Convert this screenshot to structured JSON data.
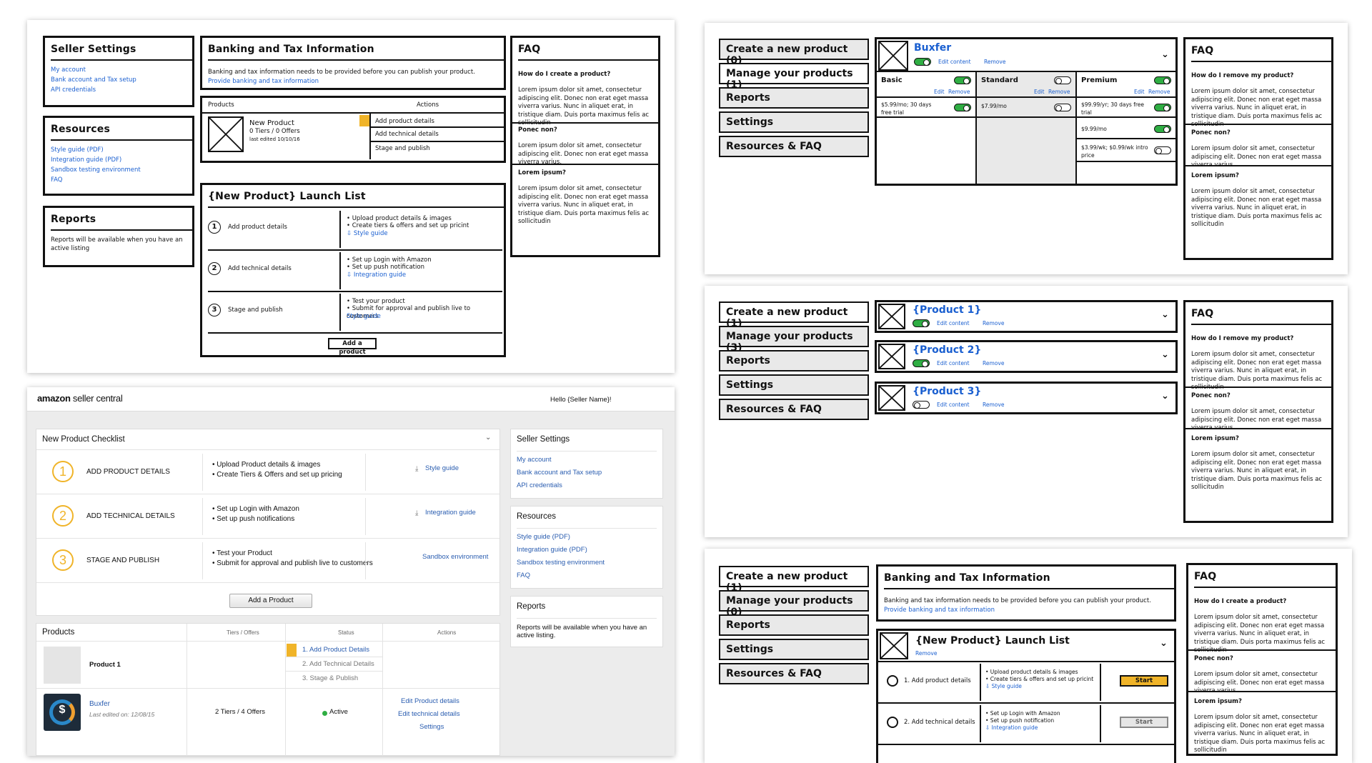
{
  "wf1": {
    "seller_settings": {
      "title": "Seller Settings",
      "links": [
        "My account",
        "Bank account and Tax setup",
        "API credentials"
      ]
    },
    "resources": {
      "title": "Resources",
      "links": [
        "Style guide (PDF)",
        "Integration guide (PDF)",
        "Sandbox testing environment",
        "FAQ"
      ]
    },
    "reports": {
      "title": "Reports",
      "text": "Reports will be available when you have an active listing"
    },
    "banking": {
      "title": "Banking and Tax Information",
      "text": "Banking and tax information needs to be provided before you can publish your product.",
      "link": "Provide banking and tax information"
    },
    "products": {
      "col_products": "Products",
      "col_actions": "Actions",
      "name": "New Product",
      "sub1": "0 Tiers / 0 Offers",
      "sub2": "last edited 10/10/16",
      "actions": [
        "Add product details",
        "Add technical details",
        "Stage and publish"
      ]
    },
    "launch": {
      "title": "{New Product} Launch List",
      "steps": [
        {
          "num": "1",
          "label": "Add product details",
          "items": [
            "• Upload product details & images",
            "• Create tiers & offers and set up pricint"
          ],
          "link": "⇩ Style guide"
        },
        {
          "num": "2",
          "label": "Add technical details",
          "items": [
            "• Set up Login with Amazon",
            "• Set up push notification"
          ],
          "link": "⇩ Integration guide"
        },
        {
          "num": "3",
          "label": "Stage and publish",
          "items": [
            "• Test your product",
            "• Submit for approval and publish live to customers"
          ],
          "link": "Style guide"
        }
      ],
      "button": "Add a product"
    },
    "faq": {
      "title": "FAQ",
      "q1": "How do I create a product?",
      "a1": "Lorem ipsum dolor sit amet, consectetur adipiscing elit. Donec non erat eget massa viverra varius. Nunc in aliquet erat, in tristique diam. Duis porta maximus felis ac sollicitudin",
      "q2": "Ponec non?",
      "a2": "Lorem ipsum dolor sit amet, consectetur adipiscing elit. Donec non erat eget massa viverra varius.",
      "q3": "Lorem ipsum?",
      "a3": "Lorem ipsum dolor sit amet, consectetur adipiscing elit. Donec non erat eget massa viverra varius. Nunc in aliquet erat, in tristique diam. Duis porta maximus felis ac sollicitudin"
    }
  },
  "wf2": {
    "nav": [
      "Create a new product (0)",
      "Manage your products (1)",
      "Reports",
      "Settings",
      "Resources & FAQ"
    ],
    "product": "Buxfer",
    "edit": "Edit content",
    "remove": "Remove",
    "tiers": [
      {
        "name": "Basic",
        "price": "$5.99/mo; 30 days free trial"
      },
      {
        "name": "Standard",
        "price": "$7.99/mo"
      },
      {
        "name": "Premium",
        "prices": [
          "$99.99/yr; 30 days free trial",
          "$9.99/mo",
          "$3.99/wk; $0.99/wk intro price"
        ]
      }
    ],
    "tier_edit": "Edit",
    "tier_remove": "Remove",
    "faq": {
      "title": "FAQ",
      "q1": "How do I remove my product?",
      "a1": "Lorem ipsum dolor sit amet, consectetur adipiscing elit. Donec non erat eget massa viverra varius. Nunc in aliquet erat, in tristique diam. Duis porta maximus felis ac sollicitudin",
      "q2": "Ponec non?",
      "a2": "Lorem ipsum dolor sit amet, consectetur adipiscing elit. Donec non erat eget massa viverra varius.",
      "q3": "Lorem ipsum?",
      "a3": "Lorem ipsum dolor sit amet, consectetur adipiscing elit. Donec non erat eget massa viverra varius. Nunc in aliquet erat, in tristique diam. Duis porta maximus felis ac sollicitudin"
    }
  },
  "wf3": {
    "nav": [
      "Create a new product (1)",
      "Manage your products (3)",
      "Reports",
      "Settings",
      "Resources & FAQ"
    ],
    "products": [
      "{Product 1}",
      "{Product 2}",
      "{Product 3}"
    ],
    "edit": "Edit content",
    "remove": "Remove"
  },
  "wf4": {
    "nav": [
      "Create a new product (1)",
      "Manage your products (0)",
      "Reports",
      "Settings",
      "Resources & FAQ"
    ],
    "banking_title": "Banking and Tax Information",
    "banking_text": "Banking and tax information needs to be provided before you can publish your product.",
    "banking_link": "Provide banking and tax information",
    "launch_title": "{New Product} Launch List",
    "launch_remove": "Remove",
    "steps": [
      {
        "label": "1. Add product details",
        "items": [
          "• Upload product details & images",
          "• Create tiers & offers and set up pricint"
        ],
        "link": "⇩ Style guide",
        "button": "Start"
      },
      {
        "label": "2. Add technical details",
        "items": [
          "• Set up Login with Amazon",
          "• Set up push notification"
        ],
        "link": "⇩ Integration guide",
        "button": "Start"
      }
    ]
  },
  "az": {
    "logo_a": "amazon",
    "logo_b": "seller central",
    "greeting": "Hello {Seller Name}!",
    "checklist": {
      "title": "New Product Checklist",
      "steps": [
        {
          "num": "1",
          "label": "ADD PRODUCT DETAILS",
          "items": [
            "• Upload Product details & images",
            "• Create Tiers & Offers and set up pricing"
          ],
          "link": "Style guide"
        },
        {
          "num": "2",
          "label": "ADD TECHNICAL DETAILS",
          "items": [
            "• Set up Login with Amazon",
            "• Set up push notifications"
          ],
          "link": "Integration guide"
        },
        {
          "num": "3",
          "label": "STAGE AND PUBLISH",
          "items": [
            "• Test your Product",
            "• Submit for approval and publish live to customers"
          ],
          "link": "Sandbox environment"
        }
      ],
      "button": "Add a Product"
    },
    "seller_settings": {
      "title": "Seller Settings",
      "links": [
        "My account",
        "Bank account and Tax setup",
        "API credentials"
      ]
    },
    "resources": {
      "title": "Resources",
      "links": [
        "Style guide (PDF)",
        "Integration guide (PDF)",
        "Sandbox testing environment",
        "FAQ"
      ]
    },
    "reports": {
      "title": "Reports",
      "text": "Reports will be available when you have an active listing."
    },
    "products": {
      "title": "Products",
      "col_tiers": "Tiers / Offers",
      "col_status": "Status",
      "col_actions": "Actions",
      "p1": {
        "name": "Product 1",
        "status": [
          "1. Add Product Details",
          "2. Add Technical Details",
          "3. Stage & Publish"
        ]
      },
      "p2": {
        "name": "Buxfer",
        "edited": "Last edited on: 12/08/15",
        "tiers": "2 Tiers / 4 Offers",
        "status": "Active",
        "actions": [
          "Edit Product details",
          "Edit technical details",
          "Settings"
        ]
      }
    },
    "colors": {
      "accent": "#f0b429",
      "link": "#2a5db0",
      "active": "#2fae43"
    }
  }
}
